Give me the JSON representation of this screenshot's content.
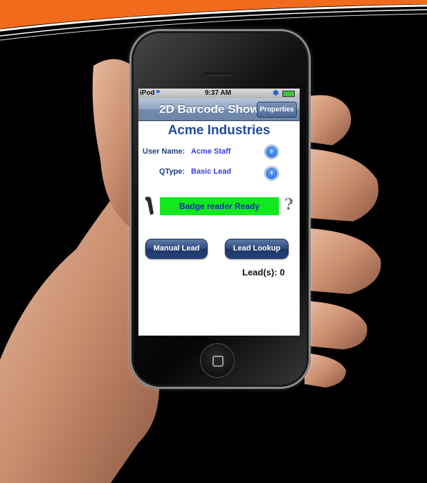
{
  "status_bar": {
    "carrier": "iPod",
    "time": "9:37 AM"
  },
  "nav_bar": {
    "title": "2D Barcode Show",
    "properties_button": "Properties"
  },
  "company_name": "Acme Industries",
  "fields": [
    {
      "label": "User Name:",
      "value": "Acme Staff"
    },
    {
      "label": "QType:",
      "value": "Basic Lead"
    }
  ],
  "badge_reader": {
    "status": "Badge reader Ready",
    "status_color": "#11e81e",
    "help_symbol": "?"
  },
  "buttons": {
    "manual_lead": "Manual Lead",
    "lead_lookup": "Lead Lookup"
  },
  "leads": {
    "label": "Lead(s):",
    "count": "0"
  },
  "colors": {
    "accent_swoosh": "#f26a1b",
    "nav_bar": "#7f96b6",
    "title_text": "#1d4c94"
  }
}
